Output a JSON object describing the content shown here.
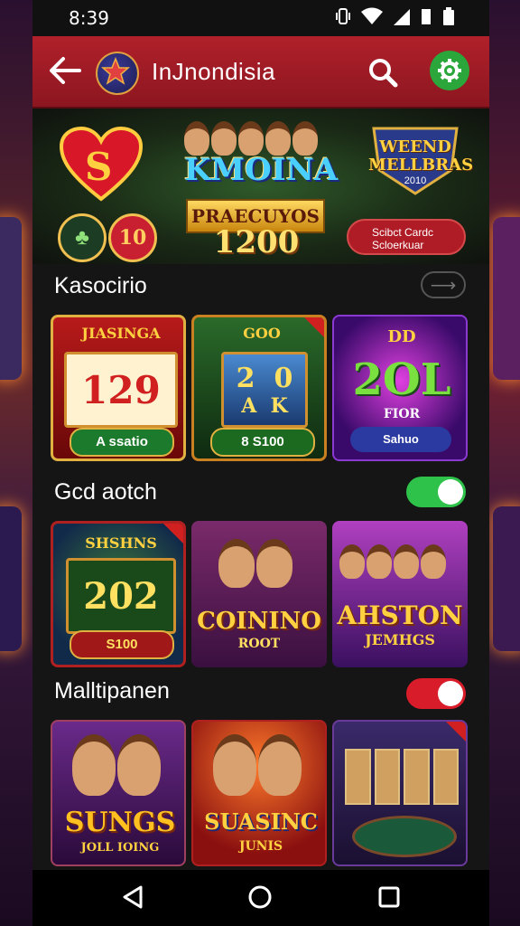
{
  "status": {
    "time": "8:39"
  },
  "appbar": {
    "title": "InJnondisia"
  },
  "hero": {
    "heart_letter": "S",
    "chip_value": "10",
    "promo_title": "KMOINA",
    "promo_ribbon": "PRAECUYOS",
    "promo_amount": "1200",
    "badge_line1": "WEEND",
    "badge_line2": "MELLBRAS",
    "badge_year": "2010",
    "button_line1": "Scibct Cardc",
    "button_line2": "Scloerkuar"
  },
  "sections": [
    {
      "title": "Kasocirio",
      "more_label": "⟶",
      "cards": [
        {
          "reels": [
            "1",
            "2",
            "9"
          ],
          "foot": "A ssatio",
          "title": "JIASINGA"
        },
        {
          "reels": [
            "2",
            "0"
          ],
          "sub": [
            "A",
            "K"
          ],
          "foot": "8 S100",
          "title": "GOO"
        },
        {
          "big": "2OL",
          "foot": "Sahuo",
          "title": "DD",
          "sub_title": "FIOR"
        }
      ]
    },
    {
      "title": "Gcd aotch",
      "toggle": "on",
      "cards": [
        {
          "reels": [
            "2",
            "0",
            "2"
          ],
          "title": "SHSHNS",
          "foot": "S100"
        },
        {
          "title": "COININO",
          "sub": "ROOT"
        },
        {
          "title": "AHSTON",
          "sub": "JEMHGS"
        }
      ]
    },
    {
      "title": "Malltipanen",
      "toggle": "on-red",
      "cards": [
        {
          "title": "SUNGS",
          "sub": "JOLL IOING"
        },
        {
          "title": "SUASINC",
          "sub": "JUNIS"
        },
        {
          "title": ""
        }
      ]
    }
  ],
  "colors": {
    "appbar": "#a01c26",
    "toggle_green": "#2ec24a",
    "toggle_red": "#d81c2a"
  }
}
